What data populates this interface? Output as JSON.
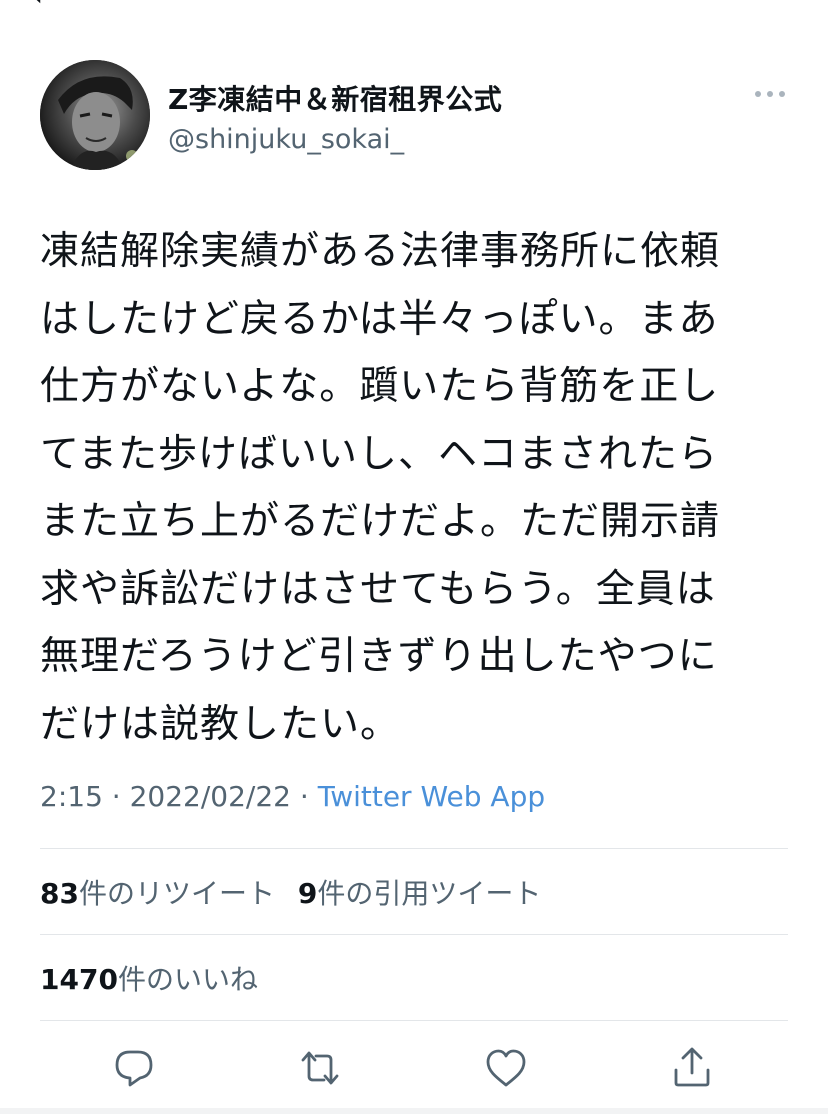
{
  "author": {
    "display_name": "Z李凍結中＆新宿租界公式",
    "handle": "@shinjuku_sokai_"
  },
  "tweet": {
    "lines": [
      "凍結解除実績がある法律事務所に依頼",
      "はしたけど戻るかは半々っぽい。まあ",
      "仕方がないよな。躓いたら背筋を正し",
      "てまた歩けばいいし、ヘコまされたら",
      "また立ち上がるだけだよ。ただ開示請",
      "求や訴訟だけはさせてもらう。全員は",
      "無理だろうけど引きずり出したやつに",
      "だけは説教したい。"
    ],
    "time": "2:15",
    "sep": "·",
    "date": "2022/02/22",
    "source": "Twitter Web App"
  },
  "stats": {
    "retweets_count": "83",
    "retweets_label": "件のリツイート",
    "quotes_count": "9",
    "quotes_label": "件の引用ツイート",
    "likes_count": "1470",
    "likes_label": "件のいいね"
  },
  "icons": {
    "more": "more-horizontal-icon",
    "reply": "reply-icon",
    "retweet": "retweet-icon",
    "like": "heart-icon",
    "share": "share-icon"
  },
  "colors": {
    "text": "#0f1419",
    "secondary": "#536471",
    "link": "#4a90d9",
    "divider": "#e3e6e9"
  }
}
